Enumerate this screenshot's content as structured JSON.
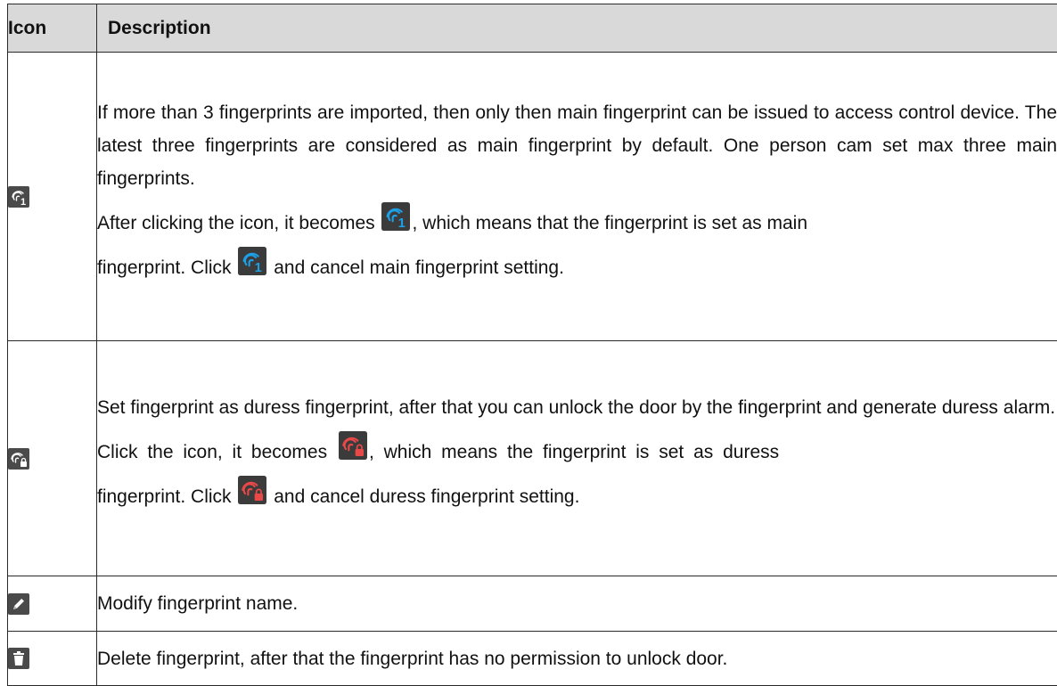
{
  "table": {
    "headers": {
      "icon": "Icon",
      "description": "Description"
    },
    "rows": [
      {
        "icon": "main-fingerprint-icon",
        "paragraphs": [
          "If more than 3 fingerprints are imported, then only then main fingerprint can be issued to access control device. The latest three fingerprints are considered as main fingerprint by default. One person cam set max three main fingerprints."
        ],
        "after_a": "After clicking the icon, it becomes",
        "after_b": ", which means that the fingerprint is set as main",
        "after_c": "fingerprint. Click",
        "after_d": "and cancel main fingerprint setting.",
        "active_icon": "main-fingerprint-active-icon"
      },
      {
        "icon": "duress-fingerprint-icon",
        "paragraphs": [
          "Set fingerprint as duress fingerprint, after that you can unlock the door by the fingerprint and generate duress alarm."
        ],
        "after_a": "Click the icon, it becomes",
        "after_b": ", which means the fingerprint is set as duress",
        "after_c": "fingerprint. Click",
        "after_d": "and cancel duress fingerprint setting.",
        "active_icon": "duress-fingerprint-active-icon"
      },
      {
        "icon": "edit-pencil-icon",
        "text": "Modify fingerprint name."
      },
      {
        "icon": "trash-icon",
        "text": "Delete fingerprint, after that the fingerprint has no permission to unlock door."
      }
    ]
  },
  "colors": {
    "header_bg": "#d9d9d9",
    "icon_bg": "#4a4a4a",
    "main_active": "#1ea0e6",
    "duress_active": "#e84848"
  }
}
